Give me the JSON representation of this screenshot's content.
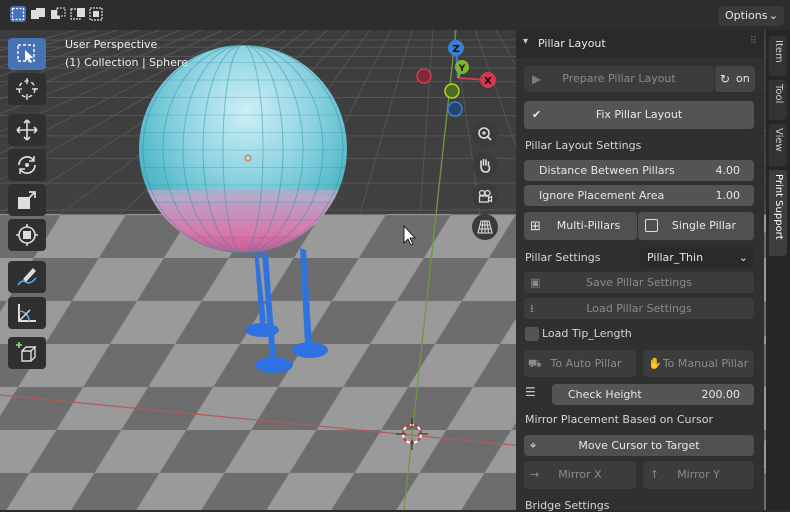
{
  "header": {
    "options_label": "Options",
    "select_modes": [
      "select-box-icon",
      "select-extend-icon",
      "select-subtract-icon",
      "select-invert-icon",
      "select-intersect-icon"
    ]
  },
  "viewport": {
    "perspective_label": "User Perspective",
    "collection_label": "(1) Collection | Sphere",
    "gizmo": {
      "z": "Z",
      "y": "Y",
      "x": "X"
    }
  },
  "toolbar": {
    "tools": [
      "select-box",
      "cursor",
      "move",
      "rotate",
      "scale",
      "transform",
      "annotate",
      "measure",
      "add-cube"
    ]
  },
  "panel": {
    "title": "Pillar Layout",
    "prepare_label": "Prepare Pillar Layout",
    "on_label": "on",
    "fix_label": "Fix Pillar Layout",
    "layout_settings_label": "Pillar Layout Settings",
    "distance": {
      "label": "Distance Between Pillars",
      "value": "4.00"
    },
    "ignore": {
      "label": "Ignore Placement Area",
      "value": "1.00"
    },
    "multi_label": "Multi-Pillars",
    "single_label": "Single Pillar",
    "pillar_settings_label": "Pillar Settings",
    "pillar_settings_value": "Pillar_Thin",
    "save_label": "Save Pillar Settings",
    "load_label": "Load Pillar Settings",
    "load_tip_label": "Load Tip_Length",
    "to_auto_label": "To Auto Pillar",
    "to_manual_label": "To Manual Pillar",
    "check_height": {
      "label": "Check Height",
      "value": "200.00"
    },
    "mirror_label": "Mirror Placement Based on Cursor",
    "move_cursor_label": "Move Cursor to Target",
    "mirror_x_label": "Mirror X",
    "mirror_y_label": "Mirror Y",
    "bridge_label": "Bridge Settings"
  },
  "side_tabs": [
    "Item",
    "Tool",
    "View",
    "Print Support"
  ],
  "colors": {
    "accent": "#4772b3",
    "sphere_top": "#9edbe8",
    "sphere_bottom": "#d65b9a",
    "pillars": "#2d72e0"
  }
}
